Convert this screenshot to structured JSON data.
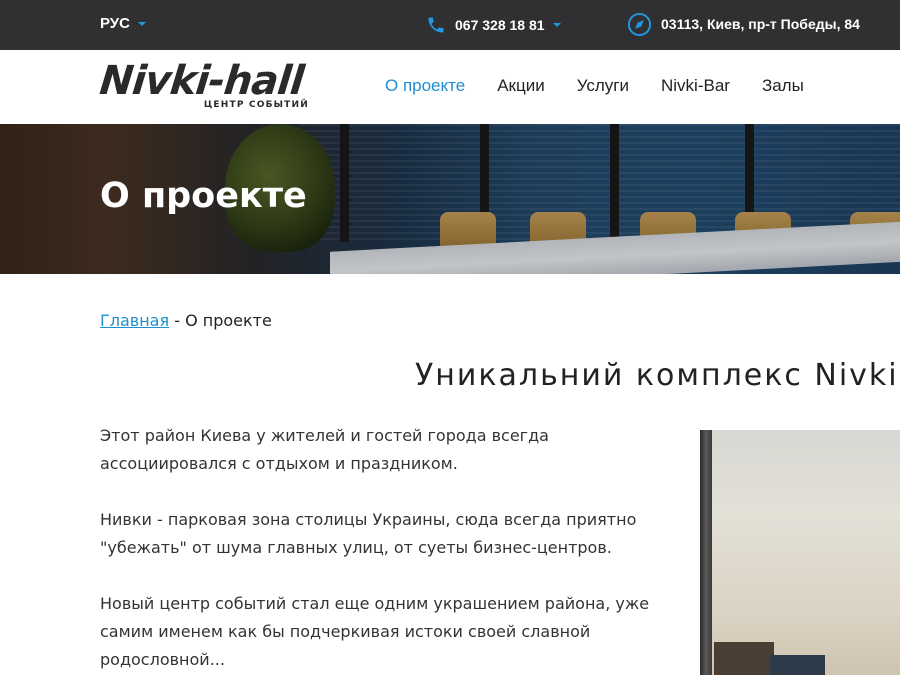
{
  "topbar": {
    "language": "РУС",
    "phone": "067 328 18 81",
    "address": "03113, Киев, пр-т Победы, 84",
    "colors": {
      "background": "#303032",
      "accent": "#1f9ae0"
    }
  },
  "header": {
    "logo": {
      "main": "Nivki-hall",
      "subtitle": "ЦЕНТР СОБЫТИЙ"
    },
    "nav": [
      {
        "label": "О проекте",
        "active": true
      },
      {
        "label": "Акции",
        "active": false
      },
      {
        "label": "Услуги",
        "active": false
      },
      {
        "label": "Nivki-Bar",
        "active": false
      },
      {
        "label": "Залы",
        "active": false
      }
    ]
  },
  "hero": {
    "title": "О проекте"
  },
  "breadcrumb": {
    "home": "Главная",
    "separator": " - ",
    "current": "О проекте"
  },
  "content": {
    "title": "Уникальний комплекс Nivki",
    "paragraphs": [
      "Этот район Киева у жителей и гостей города всегда ассоциировался с отдыхом и праздником.",
      "Нивки - парковая зона столицы Украины, сюда всегда приятно \"убежать\" от шума главных улиц, от суеты бизнес-центров.",
      "Новый центр событий стал еще одним украшением района, уже самим именем как бы подчеркивая истоки своей славной родословной..."
    ]
  },
  "icons": {
    "phone": "phone-icon",
    "compass": "compass-icon",
    "dropdown": "chevron-down-icon"
  }
}
